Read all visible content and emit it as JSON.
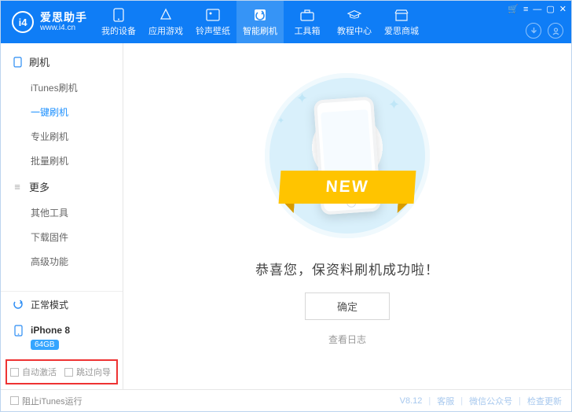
{
  "brand": {
    "logo_text": "i4",
    "title": "爱思助手",
    "url": "www.i4.cn"
  },
  "header_tabs": [
    {
      "label": "我的设备"
    },
    {
      "label": "应用游戏"
    },
    {
      "label": "铃声壁纸"
    },
    {
      "label": "智能刷机"
    },
    {
      "label": "工具箱"
    },
    {
      "label": "教程中心"
    },
    {
      "label": "爱思商城"
    }
  ],
  "sidebar": {
    "group1_title": "刷机",
    "group1_items": [
      "iTunes刷机",
      "一键刷机",
      "专业刷机",
      "批量刷机"
    ],
    "group2_title": "更多",
    "group2_items": [
      "其他工具",
      "下载固件",
      "高级功能"
    ],
    "mode": "正常模式",
    "device": "iPhone 8",
    "storage": "64GB",
    "auto_activate": "自动激活",
    "skip_wizard": "跳过向导"
  },
  "main": {
    "ribbon": "NEW",
    "success": "恭喜您，保资料刷机成功啦！",
    "ok": "确定",
    "log": "查看日志"
  },
  "footer": {
    "block_itunes": "阻止iTunes运行",
    "version": "V8.12",
    "svc": "客服",
    "wechat": "微信公众号",
    "update": "检查更新"
  }
}
